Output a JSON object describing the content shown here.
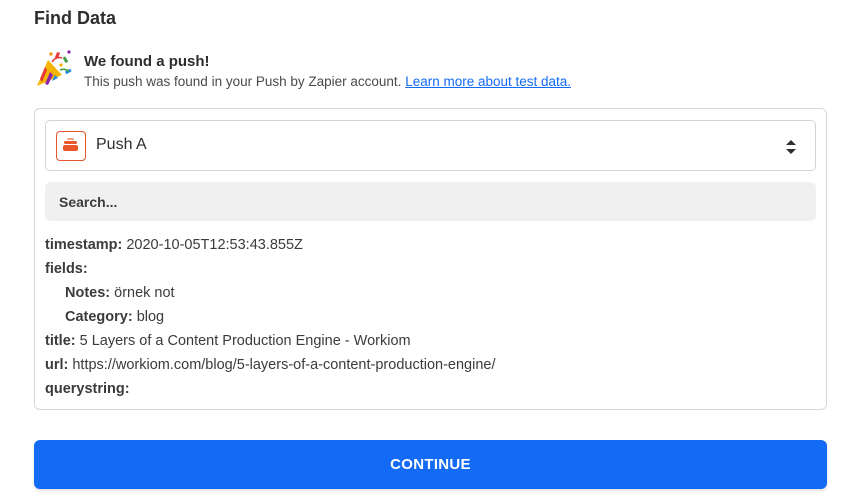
{
  "section": {
    "title": "Find Data"
  },
  "found": {
    "icon": "party-popper-icon",
    "headline": "We found a push!",
    "description": "This push was found in your Push by Zapier account.",
    "learn_more_link": "Learn more about test data."
  },
  "selector": {
    "icon": "push-app-icon",
    "selected": "Push A"
  },
  "search": {
    "placeholder": "Search..."
  },
  "data_fields": {
    "timestamp": {
      "key": "timestamp:",
      "value": "2020-10-05T12:53:43.855Z"
    },
    "fields": {
      "key": "fields:"
    },
    "notes": {
      "key": "Notes:",
      "value": "örnek not"
    },
    "category": {
      "key": "Category:",
      "value": "blog"
    },
    "title": {
      "key": "title:",
      "value": "5 Layers of a Content Production Engine - Workiom"
    },
    "url": {
      "key": "url:",
      "value": "https://workiom.com/blog/5-layers-of-a-content-production-engine/"
    },
    "querystring": {
      "key": "querystring:"
    }
  },
  "actions": {
    "continue_label": "CONTINUE"
  },
  "colors": {
    "accent": "#136bf5",
    "app_orange": "#e8562a",
    "text": "#2d2e2e"
  }
}
